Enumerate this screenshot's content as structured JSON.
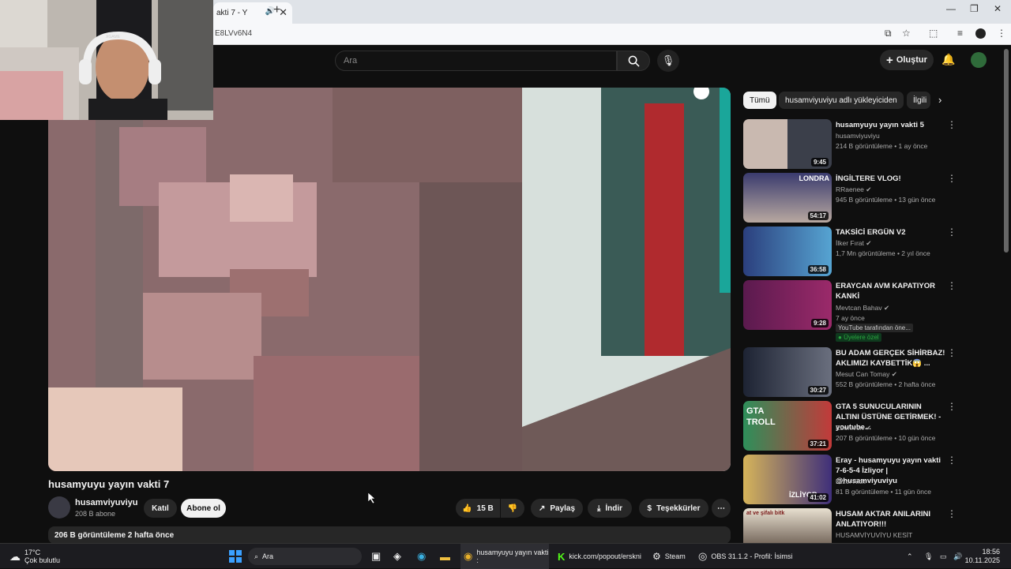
{
  "browser": {
    "tab_title": "akti 7 - Y",
    "url": "E8LVv6N4",
    "window_controls": [
      "—",
      "❐",
      "✕"
    ]
  },
  "youtube": {
    "search_placeholder": "Ara",
    "create_label": "Oluştur",
    "video": {
      "title": "husamyuyu yayın vakti 7",
      "channel": "husamviyuviyu",
      "subscribers": "208 B abone",
      "join_label": "Katıl",
      "subscribe_label": "Abone ol",
      "likes": "15 B",
      "share_label": "Paylaş",
      "download_label": "İndir",
      "thanks_label": "Teşekkürler",
      "views_date": "206 B görüntüleme  2 hafta önce"
    },
    "chips": [
      "Tümü",
      "husamviyuviyu adlı yükleyiciden",
      "İlgili"
    ],
    "recommendations": [
      {
        "title": "husamyuyu yayın vakti 5",
        "channel": "husamviyuviyu",
        "meta": "214 B görüntüleme • 1 ay önce",
        "duration": "9:45"
      },
      {
        "title": "İNGİLTERE VLOG!",
        "channel": "RRaenee",
        "meta": "945 B görüntüleme • 13 gün önce",
        "duration": "54:17",
        "thumb_text": "LONDRA"
      },
      {
        "title": "TAKSİCİ ERGÜN V2",
        "channel": "İlker Fırat",
        "meta": "1,7 Mn görüntüleme • 2 yıl önce",
        "duration": "36:58"
      },
      {
        "title": "ERAYCAN AVM KAPATIYOR KANKİ",
        "channel": "Mevtcan Bahav",
        "meta": "7 ay önce",
        "duration": "9:28",
        "badge1": "YouTube tarafından öne...",
        "badge2": "Üyelere özel"
      },
      {
        "title": "BU ADAM GERÇEK SİHİRBAZ! AKLIMIZI KAYBETTİK😱 ...",
        "channel": "Mesut Can Tomay",
        "meta": "552 B görüntüleme • 2 hafta önce",
        "duration": "30:27"
      },
      {
        "title": "GTA 5 SUNUCULARININ ALTINI ÜSTÜNE GETİRMEK! - youtube...",
        "channel": "Ebonivon",
        "meta": "207 B görüntüleme • 10 gün önce",
        "duration": "37:21",
        "thumb_text": "GTA TROLL"
      },
      {
        "title": "Eray - husamyuyu yayın vakti 7-6-5-4 İzliyor | @husamviyuviyu",
        "channel": "Dızcı Kick",
        "meta": "81 B görüntüleme • 11 gün önce",
        "duration": "41:02",
        "thumb_text": "İZLİYOR"
      },
      {
        "title": "HUSAM AKTAR ANILARINI ANLATIYOR!!!",
        "channel": "HUSAMVİYUVİYU KESİT",
        "meta": "",
        "duration": "",
        "thumb_text": "at ve şifalı bitk"
      }
    ]
  },
  "webcam_overlay_text": "XGAME",
  "taskbar": {
    "weather_temp": "17°C",
    "weather_desc": "Çok bulutlu",
    "search_label": "Ara",
    "apps": [
      {
        "label": "husamyuyu yayın vakti :"
      },
      {
        "label": "kick.com/popout/erskni"
      },
      {
        "label": "Steam"
      },
      {
        "label": "OBS 31.1.2 - Profil: İsimsi"
      }
    ],
    "time": "18:56",
    "date": "10.11.2025"
  },
  "colors": {
    "bg": "#0f0f0f",
    "chip": "#272727",
    "accent_green": "#2ba640"
  }
}
